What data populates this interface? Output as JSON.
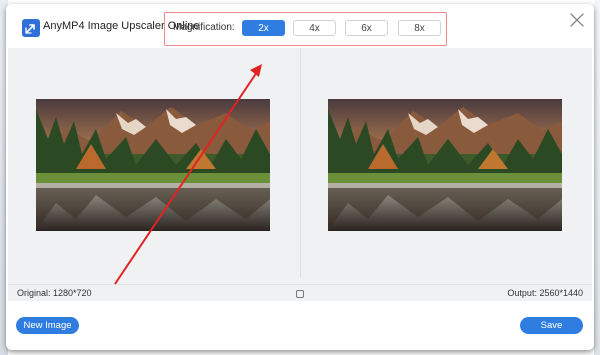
{
  "app": {
    "title": "AnyMP4 Image Upscaler Online"
  },
  "magnification": {
    "label": "Magnification:",
    "options": [
      "2x",
      "4x",
      "6x",
      "8x"
    ],
    "selected": "2x"
  },
  "status": {
    "original": "Original: 1280*720",
    "output": "Output: 2560*1440"
  },
  "footer": {
    "new_image_label": "New Image",
    "save_label": "Save"
  },
  "colors": {
    "accent": "#2f7de1",
    "highlight_box": "#f08a8a",
    "annotation_arrow": "#e02424"
  },
  "icons": {
    "logo": "upscale-arrows-icon",
    "close": "close-icon",
    "compare": "compare-icon"
  }
}
